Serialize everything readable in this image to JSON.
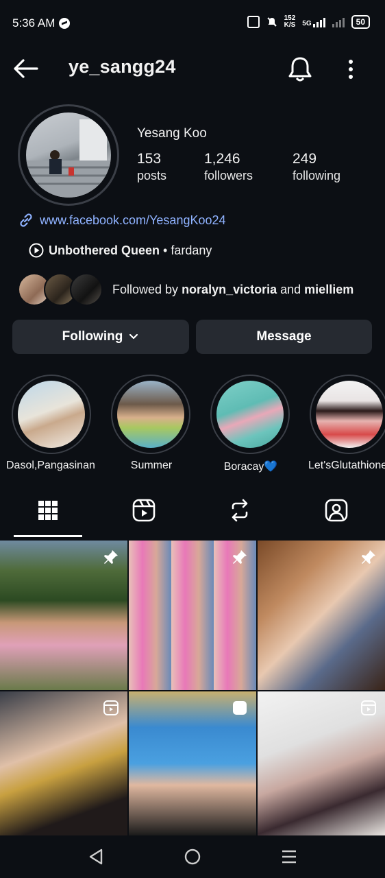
{
  "status_bar": {
    "time": "5:36 AM",
    "speed": "152",
    "speed_unit": "K/S",
    "network": "5G",
    "battery": "50"
  },
  "header": {
    "username": "ye_sangg24"
  },
  "profile": {
    "full_name": "Yesang Koo",
    "stats": [
      {
        "value": "153",
        "label": "posts"
      },
      {
        "value": "1,246",
        "label": "followers"
      },
      {
        "value": "249",
        "label": "following"
      }
    ],
    "link": "www.facebook.com/YesangKoo24",
    "music": {
      "title": "Unbothered Queen",
      "separator": " • ",
      "artist": "fardany"
    },
    "followed_by": {
      "prefix": "Followed by ",
      "user1": "noralyn_victoria",
      "joiner": " and ",
      "user2": "mielliem"
    }
  },
  "buttons": {
    "following": "Following",
    "message": "Message"
  },
  "highlights": [
    {
      "label": "Dasol,Pangasinan"
    },
    {
      "label": "Summer"
    },
    {
      "label": "Boracay💙"
    },
    {
      "label": "Let'sGlutathione"
    }
  ],
  "tabs": [
    "grid-icon",
    "reels-icon",
    "reposts-icon",
    "tagged-icon"
  ],
  "colors": {
    "background": "#0c0f14",
    "button": "#262a31",
    "link": "#8fb2ff",
    "text": "#f2f2f2"
  }
}
